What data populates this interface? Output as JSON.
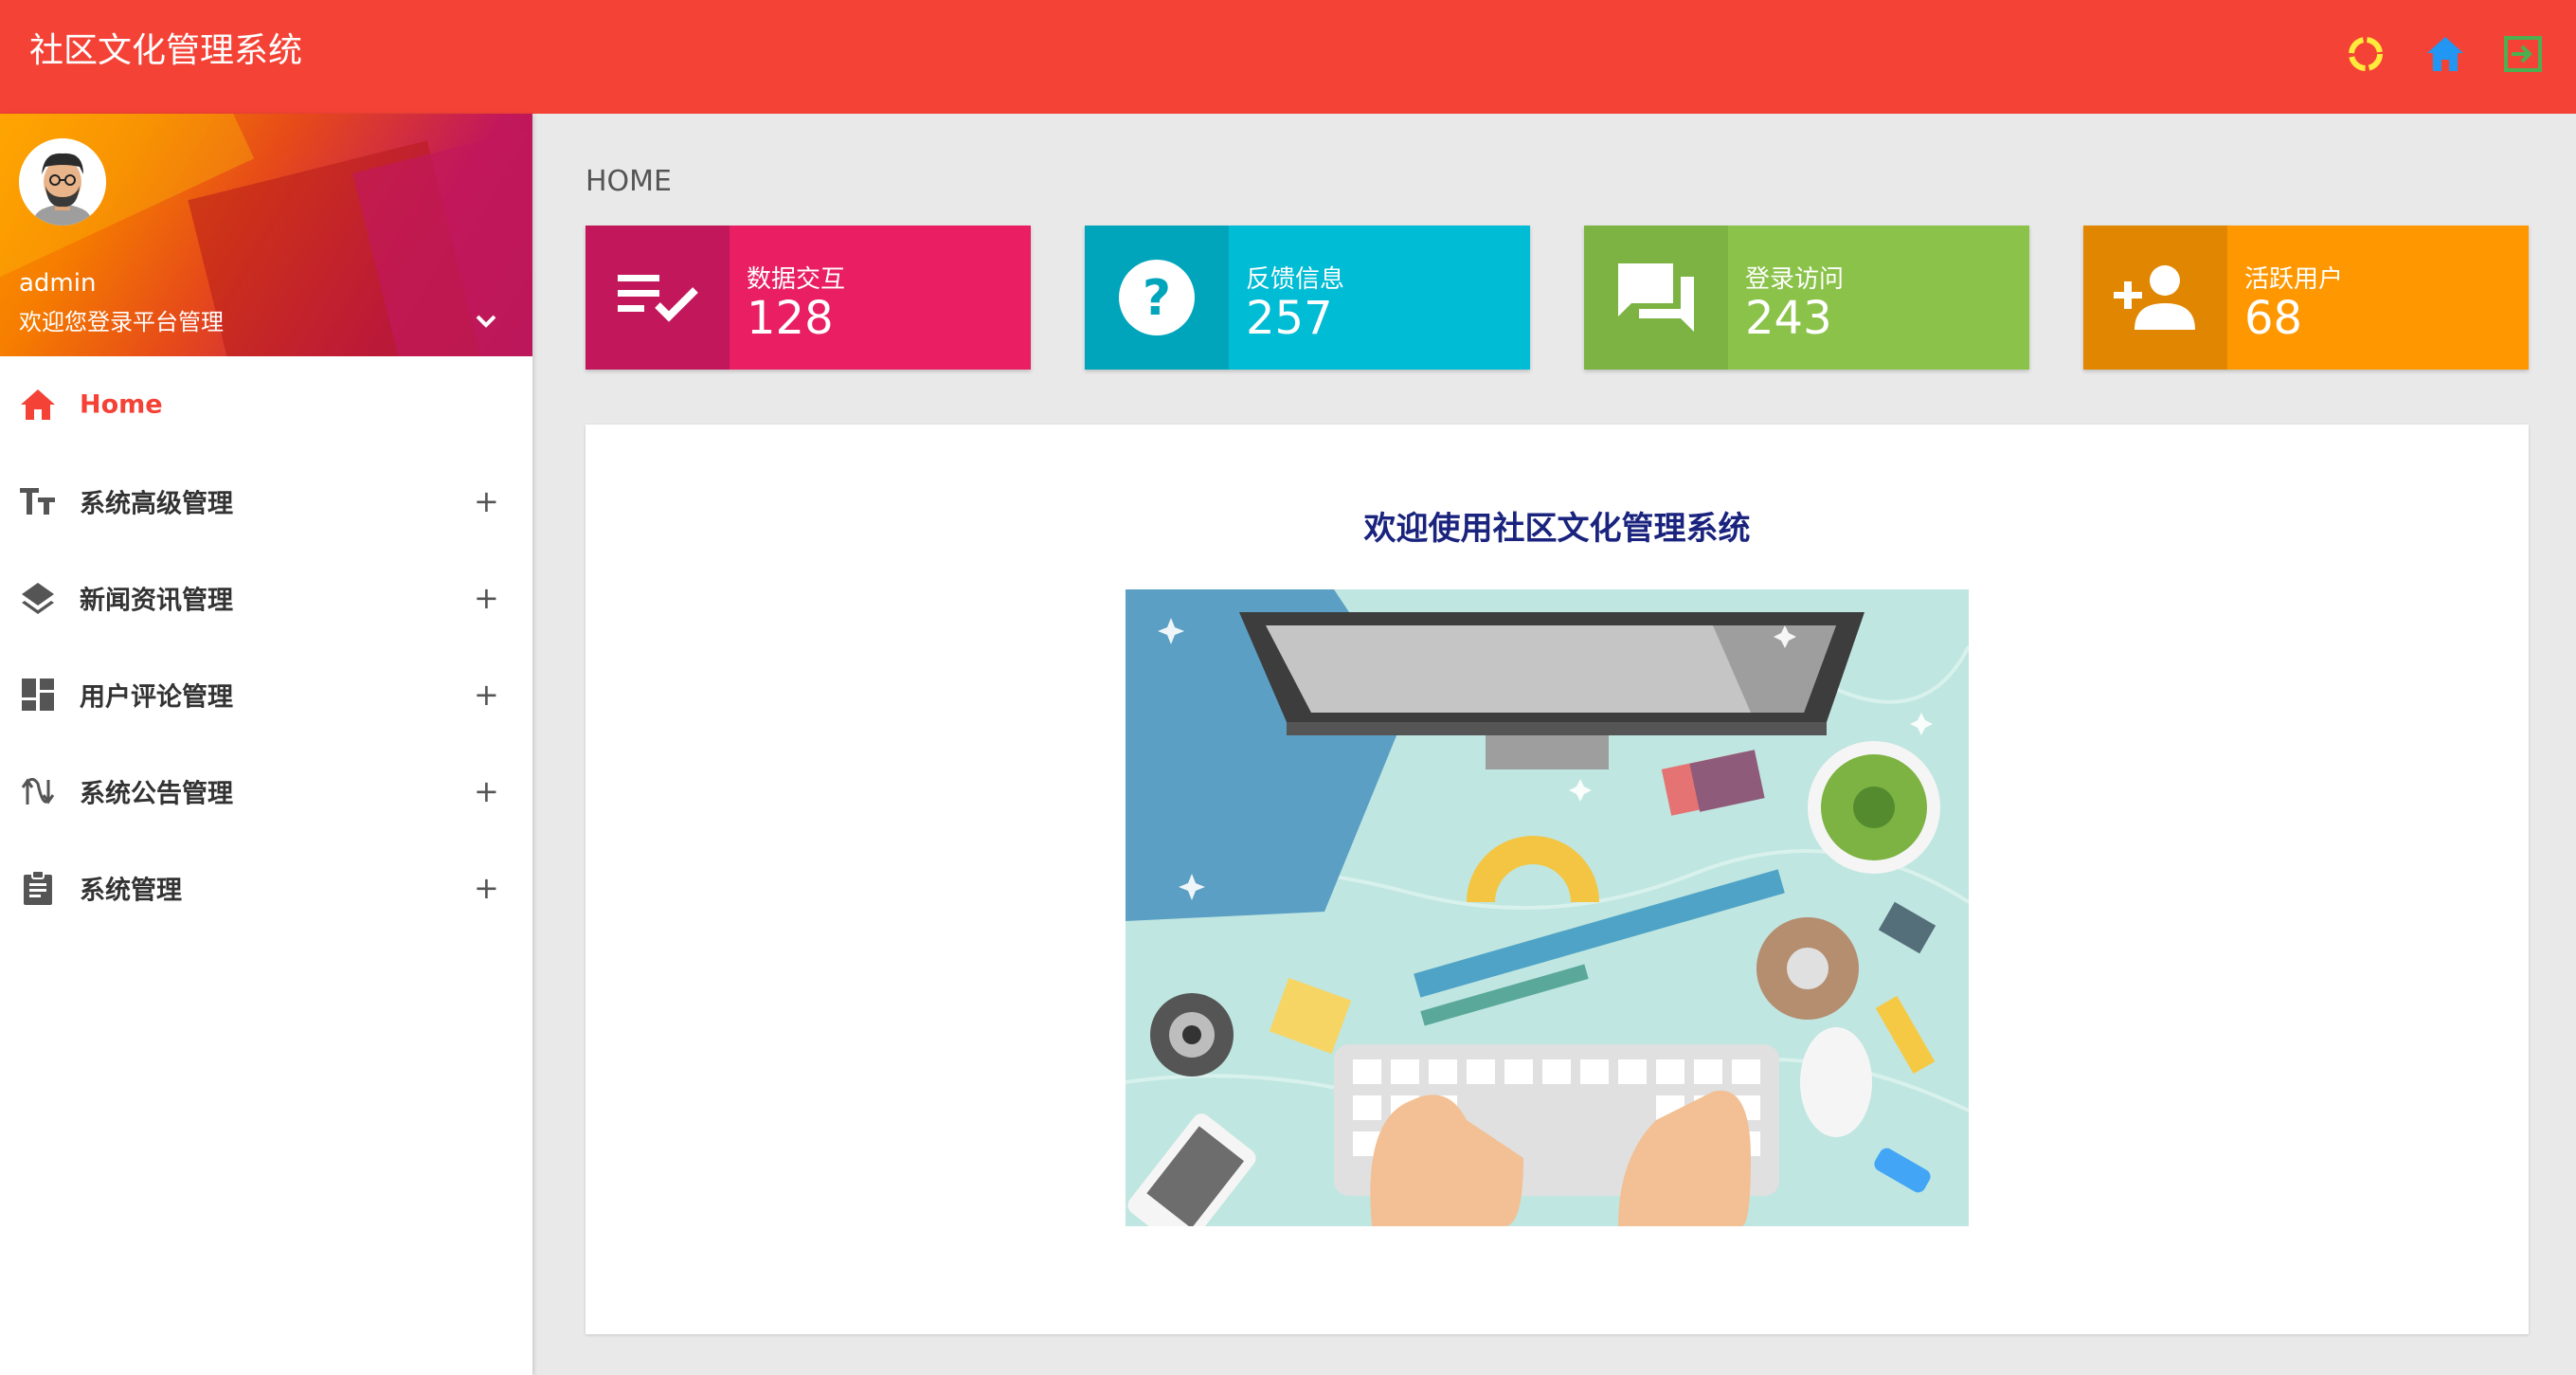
{
  "app": {
    "title": "社区文化管理系统"
  },
  "topbar": {
    "icons": [
      "refresh-circle-icon",
      "home-icon",
      "logout-icon"
    ],
    "colors": {
      "bar": "#f44336",
      "refresh": "#ffeb3b",
      "home": "#2196f3",
      "logout": "#4caf50"
    }
  },
  "user": {
    "name": "admin",
    "welcome": "欢迎您登录平台管理"
  },
  "menu": {
    "items": [
      {
        "label": "Home",
        "icon": "home-icon",
        "active": true
      },
      {
        "label": "系统高级管理",
        "icon": "text-format-icon",
        "expandable": true
      },
      {
        "label": "新闻资讯管理",
        "icon": "layers-icon",
        "expandable": true
      },
      {
        "label": "用户评论管理",
        "icon": "dashboard-icon",
        "expandable": true
      },
      {
        "label": "系统公告管理",
        "icon": "swap-icon",
        "expandable": true
      },
      {
        "label": "系统管理",
        "icon": "clipboard-icon",
        "expandable": true
      }
    ],
    "expand_symbol": "+"
  },
  "breadcrumb": "HOME",
  "stats": [
    {
      "label": "数据交互",
      "value": "128",
      "icon": "playlist-check-icon",
      "color": "#e91e63",
      "icon_bg": "#c2185b"
    },
    {
      "label": "反馈信息",
      "value": "257",
      "icon": "help-circle-icon",
      "color": "#00bcd4",
      "icon_bg": "#00a5bb"
    },
    {
      "label": "登录访问",
      "value": "243",
      "icon": "forum-icon",
      "color": "#8bc34a",
      "icon_bg": "#7cb342"
    },
    {
      "label": "活跃用户",
      "value": "68",
      "icon": "person-add-icon",
      "color": "#ff9800",
      "icon_bg": "#e08600"
    }
  ],
  "panel": {
    "title": "欢迎使用社区文化管理系统"
  }
}
